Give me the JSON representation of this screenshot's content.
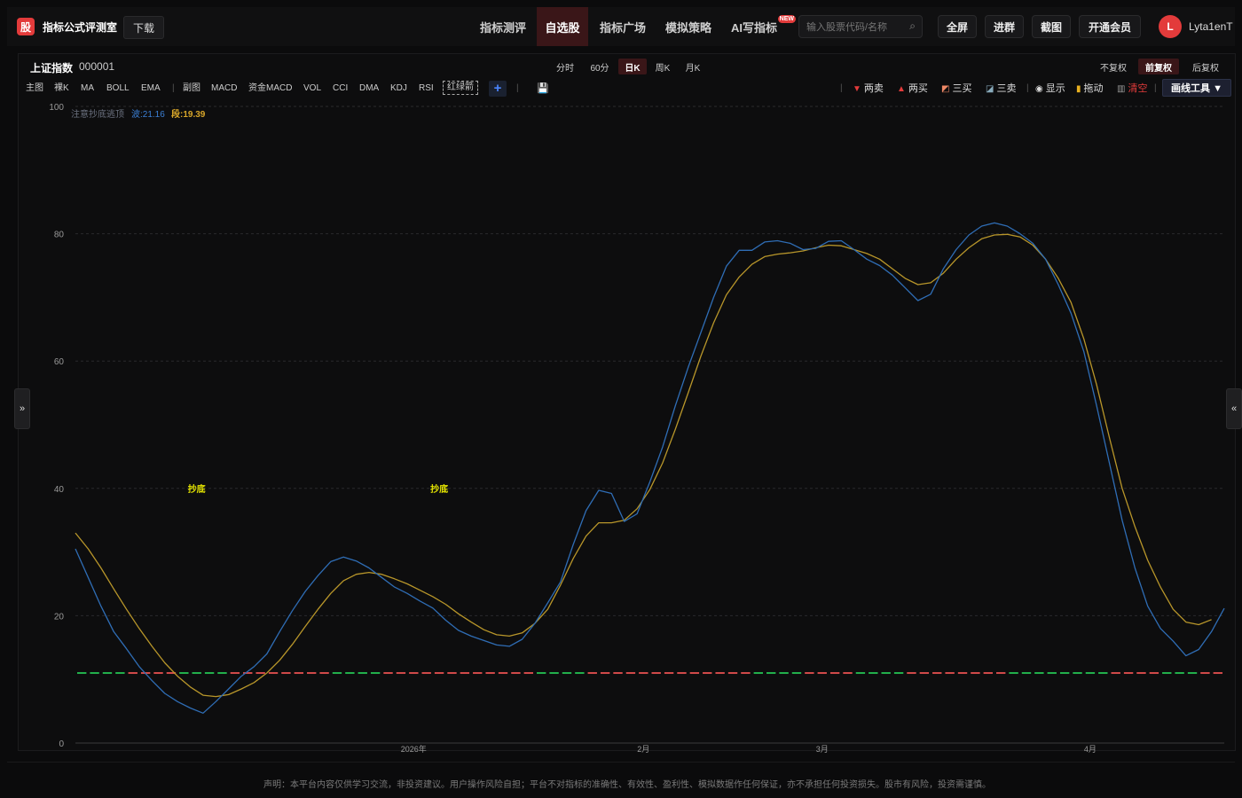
{
  "app": {
    "logo_char": "股",
    "title": "指标公式评测室",
    "download": "下载"
  },
  "nav": [
    {
      "label": "指标测评",
      "active": false
    },
    {
      "label": "自选股",
      "active": true
    },
    {
      "label": "指标广场",
      "active": false
    },
    {
      "label": "模拟策略",
      "active": false
    },
    {
      "label": "AI写指标",
      "active": false,
      "badge": "NEW"
    }
  ],
  "search": {
    "placeholder": "输入股票代码/名称"
  },
  "top_buttons": [
    "全屏",
    "进群",
    "截图",
    "开通会员"
  ],
  "user": {
    "initial": "L",
    "name": "Lyta1enT"
  },
  "stock": {
    "name": "上证指数",
    "code": "000001"
  },
  "periods": [
    {
      "label": "分时",
      "active": false
    },
    {
      "label": "60分",
      "active": false
    },
    {
      "label": "日K",
      "active": true
    },
    {
      "label": "周K",
      "active": false
    },
    {
      "label": "月K",
      "active": false
    }
  ],
  "adjust": [
    {
      "label": "不复权",
      "active": false
    },
    {
      "label": "前复权",
      "active": true
    },
    {
      "label": "后复权",
      "active": false
    }
  ],
  "indicators": {
    "main_label": "主图",
    "main": [
      "裸K",
      "MA",
      "BOLL",
      "EMA"
    ],
    "sub_label": "副图",
    "sub": [
      "MACD",
      "资金MACD",
      "VOL",
      "CCI",
      "DMA",
      "KDJ",
      "RSI"
    ],
    "custom": "红绿箭",
    "add": "+"
  },
  "tools": {
    "two_sell": "两卖",
    "two_buy": "两买",
    "three_buy": "三买",
    "three_sell": "三卖",
    "show": "显示",
    "drag": "拖动",
    "clear": "清空",
    "draw_tool": "画线工具 ▼"
  },
  "side": {
    "left": "»",
    "right": "«"
  },
  "colors": {
    "bg": "#0b0b0c",
    "accent_red": "#e33b3b",
    "wave_line": "#2f6db5",
    "segment_line": "#b8962a",
    "bottom_green": "#22b14c",
    "bottom_red": "#d24a4a",
    "marker": "#e6e600"
  },
  "chart_data": {
    "type": "line",
    "legend_title": "注意抄底逃顶",
    "legend_items": [
      {
        "label": "波:21.16",
        "color": "#3b7fd4"
      },
      {
        "label": "段:19.39",
        "color": "#d8a62a"
      }
    ],
    "ylim": [
      0,
      100
    ],
    "yticks": [
      0,
      20,
      40,
      60,
      80,
      100
    ],
    "grid": true,
    "xticks": [
      {
        "label": "2026年",
        "index": 26.5
      },
      {
        "label": "2月",
        "index": 44.5
      },
      {
        "label": "3月",
        "index": 58.5
      },
      {
        "label": "4月",
        "index": 79.5
      }
    ],
    "annotations": [
      {
        "label": "抄底",
        "index": 9.5,
        "y": 40
      },
      {
        "label": "抄底",
        "index": 28.5,
        "y": 40
      }
    ],
    "series": [
      {
        "name": "波",
        "color": "#2f6db5",
        "values": [
          30.5,
          26,
          21.5,
          17.5,
          14.8,
          12,
          9.8,
          7.8,
          6.5,
          5.5,
          4.7,
          6.5,
          8.5,
          10.5,
          12,
          14,
          17.5,
          20.8,
          23.8,
          26.3,
          28.5,
          29.2,
          28.6,
          27.5,
          26,
          24.5,
          23.5,
          22.3,
          21.2,
          19.3,
          17.7,
          16.8,
          16.1,
          15.4,
          15.2,
          16.3,
          18.8,
          22,
          25.3,
          31.2,
          36.5,
          39.7,
          39.2,
          34.8,
          36,
          41,
          46.5,
          53,
          59,
          64.5,
          70,
          74.9,
          77.4,
          77.4,
          78.7,
          78.9,
          78.5,
          77.5,
          77.7,
          78.8,
          78.9,
          77.5,
          76,
          75,
          73.5,
          71.5,
          69.5,
          70.5,
          74.5,
          77.5,
          79.8,
          81.2,
          81.7,
          81.2,
          80,
          78.5,
          76,
          72,
          67.5,
          61.5,
          53,
          44,
          35,
          27.5,
          21.5,
          18,
          16,
          13.7,
          14.7,
          17.5,
          21.16
        ]
      },
      {
        "name": "段",
        "color": "#b8962a",
        "values": [
          33,
          30.5,
          27.5,
          24.2,
          21,
          18,
          15.2,
          12.6,
          10.5,
          8.8,
          7.5,
          7.3,
          7.6,
          8.5,
          9.5,
          11,
          13,
          15.5,
          18.3,
          21,
          23.5,
          25.5,
          26.5,
          26.8,
          26.5,
          25.8,
          25,
          24,
          23,
          21.8,
          20.3,
          19,
          17.8,
          17,
          16.8,
          17.3,
          18.8,
          21,
          24.8,
          29,
          32.5,
          34.6,
          34.6,
          35,
          36.8,
          39.8,
          44,
          49.3,
          55,
          60.8,
          66,
          70.4,
          73.2,
          75.2,
          76.4,
          76.8,
          77,
          77.3,
          77.8,
          78.2,
          78.1,
          77.5,
          76.9,
          76,
          74.5,
          73,
          72,
          72.3,
          73.8,
          76,
          77.8,
          79.2,
          79.8,
          79.9,
          79.5,
          78.2,
          76,
          73,
          69.2,
          63.5,
          56.3,
          48,
          40,
          34,
          28.7,
          24.5,
          21,
          19,
          18.6,
          19.39
        ]
      }
    ],
    "baseline": {
      "y": 11,
      "colors": [
        "g",
        "g",
        "g",
        "g",
        "r",
        "r",
        "r",
        "r",
        "g",
        "g",
        "g",
        "g",
        "r",
        "r",
        "r",
        "r",
        "r",
        "r",
        "r",
        "r",
        "g",
        "g",
        "g",
        "g",
        "r",
        "r",
        "r",
        "r",
        "r",
        "r",
        "r",
        "r",
        "r",
        "r",
        "r",
        "r",
        "g",
        "g",
        "g",
        "g",
        "r",
        "r",
        "r",
        "r",
        "r",
        "r",
        "r",
        "r",
        "r",
        "r",
        "r",
        "r",
        "r",
        "g",
        "g",
        "g",
        "g",
        "r",
        "r",
        "r",
        "r",
        "g",
        "g",
        "g",
        "g",
        "r",
        "r",
        "r",
        "r",
        "r",
        "r",
        "r",
        "r",
        "g",
        "g",
        "g",
        "g",
        "g",
        "g",
        "g",
        "g",
        "r",
        "r",
        "r",
        "r",
        "g",
        "g",
        "g",
        "r",
        "r",
        "r"
      ]
    }
  },
  "footer": {
    "disclaimer": "声明：本平台内容仅供学习交流，非投资建议。用户操作风险自担；平台不对指标的准确性、有效性、盈利性、模拟数据作任何保证，亦不承担任何投资损失。股市有风险，投资需谨慎。"
  }
}
